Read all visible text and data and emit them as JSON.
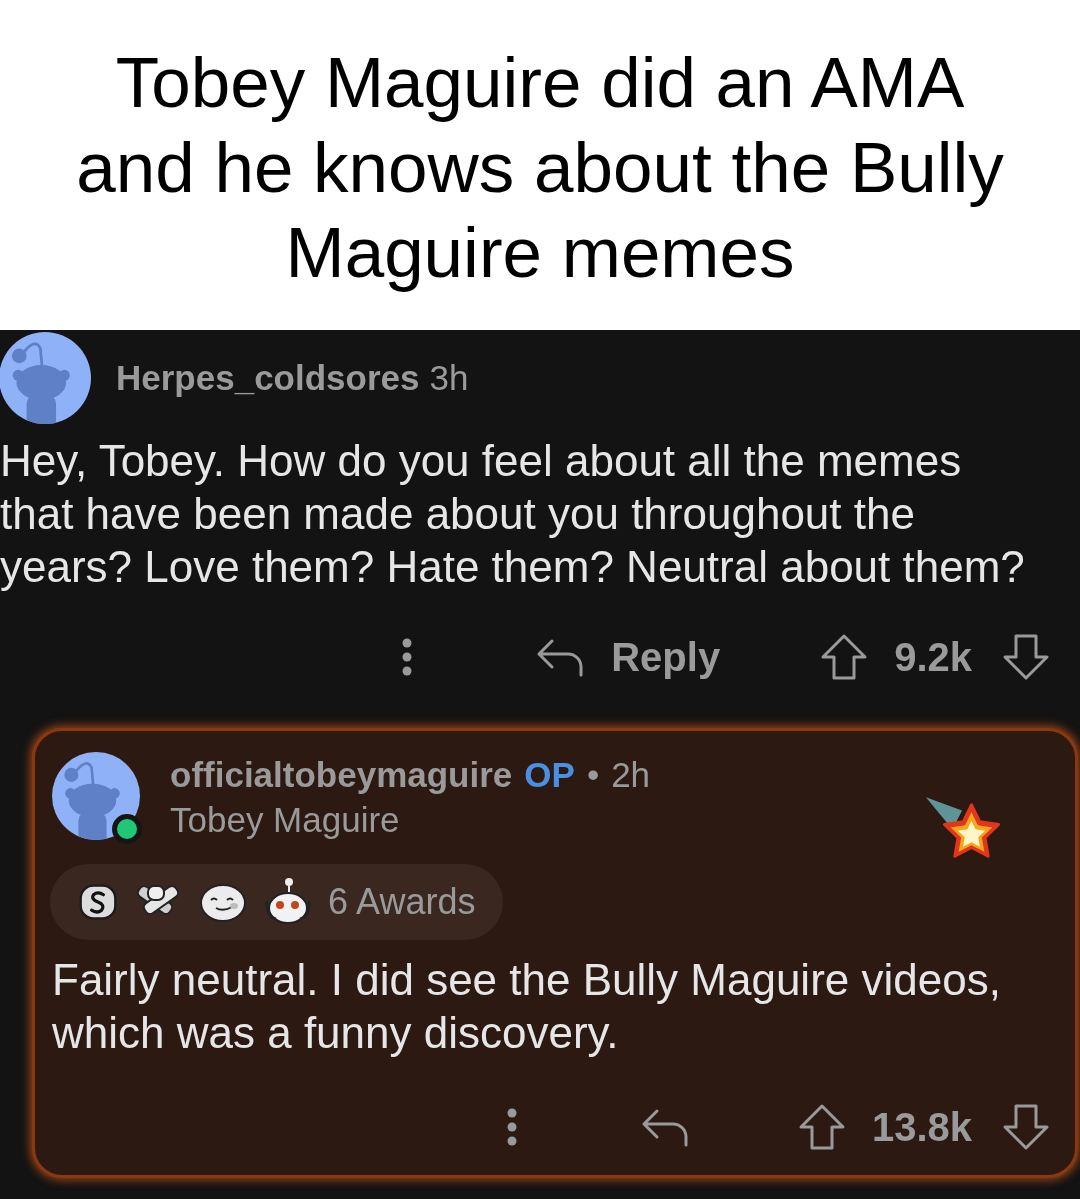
{
  "caption": "Tobey Maguire did an AMA and he knows about the Bully Maguire memes",
  "comment": {
    "author": "Herpes_coldsores",
    "time": "3h",
    "body": "Hey, Tobey. How do you feel about all the memes that have been made about you throughout the years? Love them? Hate them? Neutral about them?",
    "reply_label": "Reply",
    "score": "9.2k"
  },
  "reply": {
    "author": "officialtobeymaguire",
    "op_badge": "OP",
    "separator": "•",
    "time": "2h",
    "flair": "Tobey Maguire",
    "online": true,
    "awards_label": "6 Awards",
    "body": "Fairly neutral. I did see the Bully Maguire videos, which was a funny discovery.",
    "score": "13.8k"
  }
}
